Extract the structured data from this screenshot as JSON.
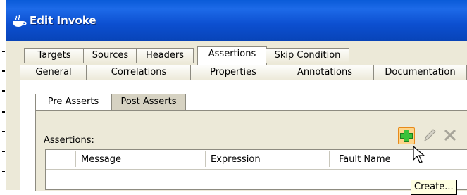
{
  "window": {
    "title": "Edit Invoke"
  },
  "tabs": {
    "row_top": [
      "Targets",
      "Sources",
      "Headers",
      "Assertions",
      "Skip Condition"
    ],
    "row_bottom": [
      "General",
      "Correlations",
      "Properties",
      "Annotations",
      "Documentation"
    ],
    "selected": "Assertions"
  },
  "subtabs": {
    "items": [
      "Pre Asserts",
      "Post Asserts"
    ],
    "selected": "Pre Asserts"
  },
  "assertions": {
    "label_mnemonic": "A",
    "label_rest": "ssertions:",
    "columns": [
      "Message",
      "Expression",
      "Fault Name"
    ]
  },
  "toolbar": {
    "add_icon": "add-icon",
    "edit_icon": "pencil-icon",
    "delete_icon": "delete-icon",
    "accent": "#2ea82e"
  },
  "tooltip": {
    "text": "Create..."
  }
}
